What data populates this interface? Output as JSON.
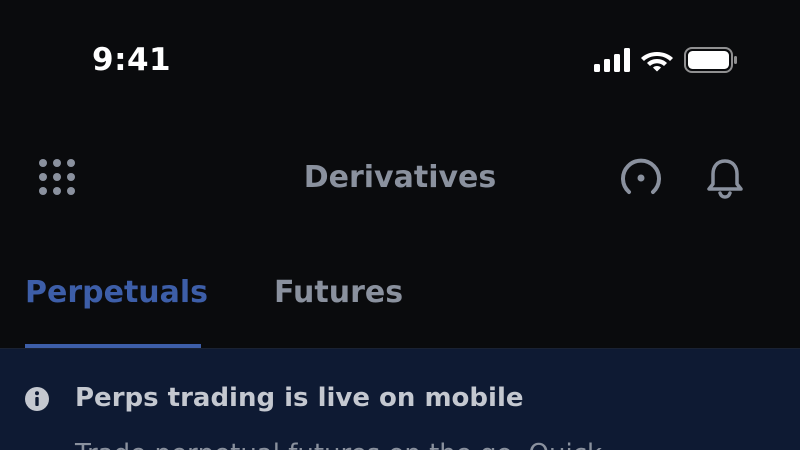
{
  "status_bar": {
    "time": "9:41",
    "icons": [
      "signal-icon",
      "wifi-icon",
      "battery-icon"
    ]
  },
  "header": {
    "title": "Derivatives",
    "left_icon": "grid-menu-icon",
    "right_icons": [
      "gauge-icon",
      "bell-icon"
    ]
  },
  "tabs": [
    {
      "label": "Perpetuals",
      "active": true
    },
    {
      "label": "Futures",
      "active": false
    }
  ],
  "banner": {
    "icon": "info-icon",
    "title": "Perps trading is live on mobile",
    "body": "Trade perpetual futures on the go. Quick"
  },
  "colors": {
    "background": "#0a0b0d",
    "accent": "#3d5ea8",
    "muted_text": "#8a919e",
    "banner_bg": "#0e1a33"
  }
}
